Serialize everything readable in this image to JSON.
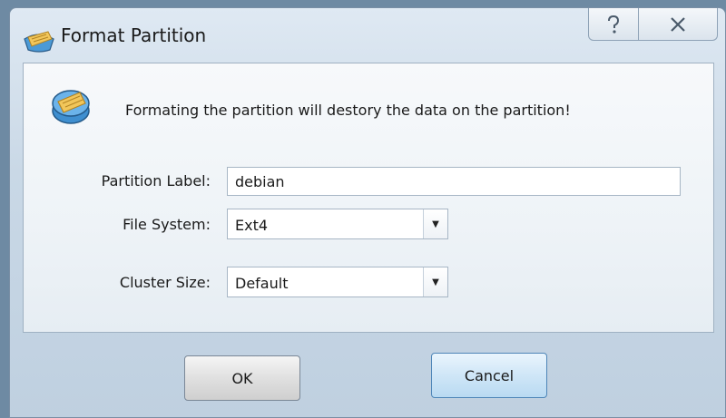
{
  "window": {
    "title": "Format Partition",
    "help_label": "?",
    "close_label": "X"
  },
  "dialog": {
    "warning": "Formating the partition will destory the data on the partition!",
    "fields": {
      "label": {
        "label": "Partition Label:",
        "value": "debian"
      },
      "filesystem": {
        "label": "File System:",
        "value": "Ext4"
      },
      "cluster": {
        "label": "Cluster Size:",
        "value": "Default"
      }
    }
  },
  "buttons": {
    "ok": "OK",
    "cancel": "Cancel"
  },
  "icons": {
    "app": "partition-tool-icon",
    "warning": "disk-warning-icon",
    "help": "question-icon",
    "close": "close-icon",
    "dropdown": "chevron-down-icon"
  }
}
